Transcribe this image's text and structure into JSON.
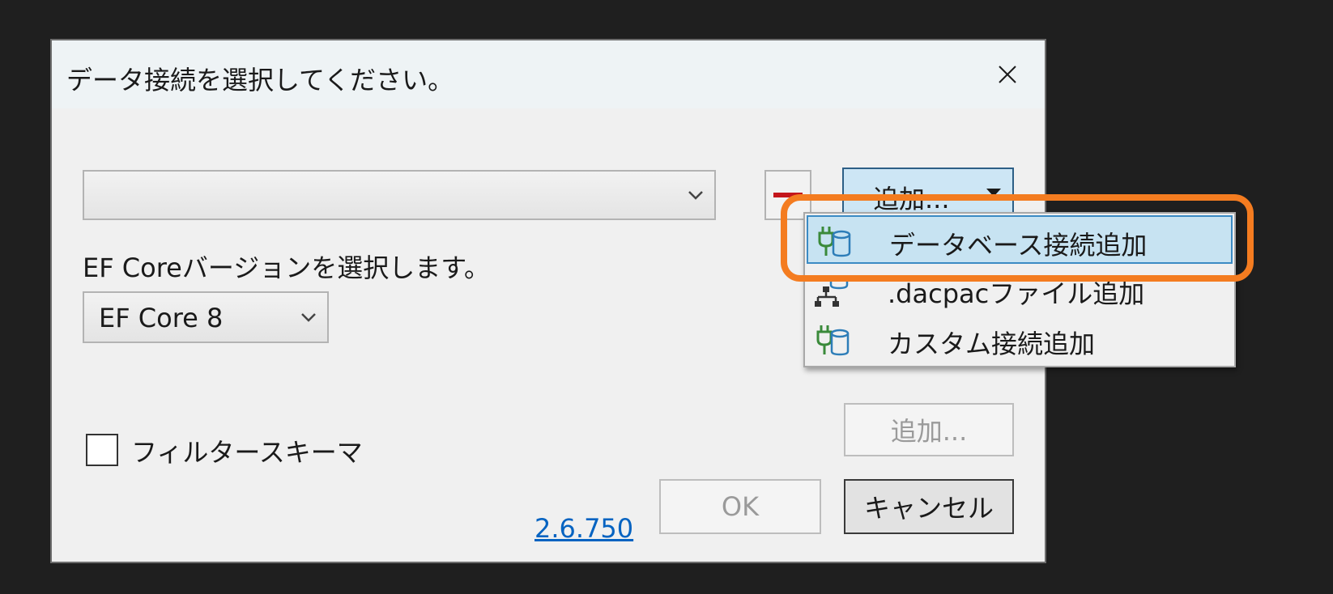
{
  "dialog": {
    "title": "データ接続を選択してください。",
    "close_icon": "close-icon"
  },
  "connection": {
    "selected_value": "",
    "remove_icon": "minus-icon",
    "add_button_label": "追加...",
    "add_menu_open": true,
    "add_menu_items": [
      {
        "label": "データベース接続追加",
        "icon": "plug-database-icon",
        "highlighted": true
      },
      {
        "label": ".dacpacファイル追加",
        "icon": "network-database-icon",
        "highlighted": false
      },
      {
        "label": "カスタム接続追加",
        "icon": "plug-database-icon",
        "highlighted": false
      }
    ]
  },
  "ef_core": {
    "label": "EF Coreバージョンを選択します。",
    "selected_value": "EF Core 8"
  },
  "filter": {
    "checkbox_label": "フィルタースキーマ",
    "checked": false,
    "add_button_label": "追加..."
  },
  "footer": {
    "version_link": "2.6.750",
    "ok_label": "OK",
    "cancel_label": "キャンセル"
  },
  "colors": {
    "callout": "#f47c20",
    "menu_highlight": "#c7e3f2",
    "remove_icon": "#c4161c",
    "link": "#0563c1"
  }
}
